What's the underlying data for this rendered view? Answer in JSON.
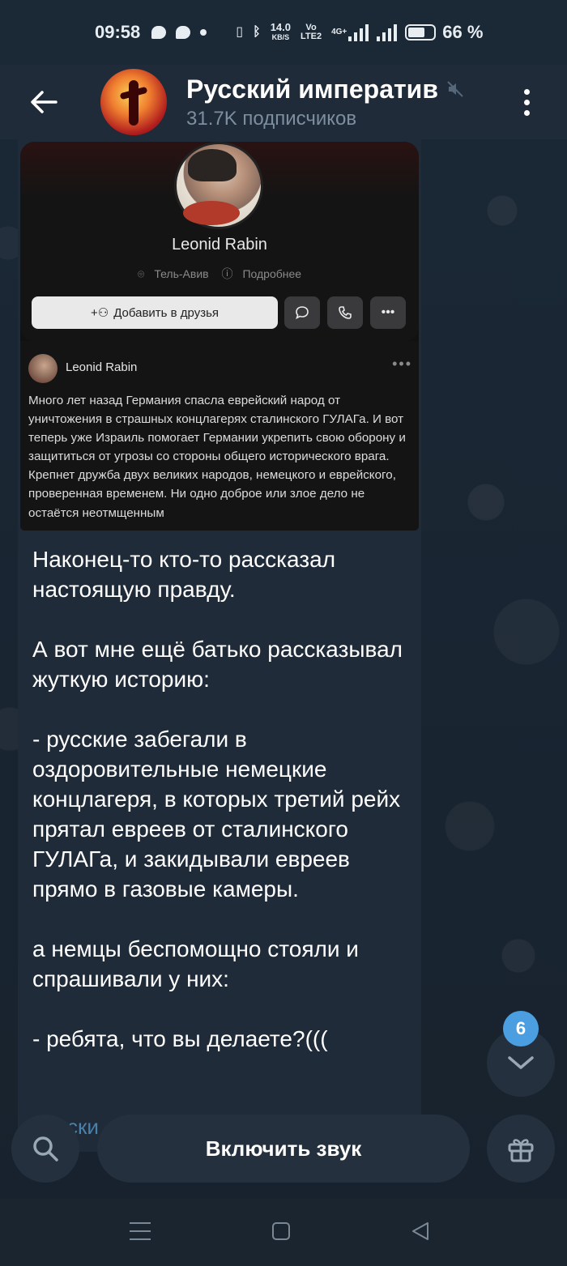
{
  "status_bar": {
    "time": "09:58",
    "network_speed": "14.0",
    "network_speed_unit": "KB/S",
    "volte": "Vo",
    "lte": "LTE2",
    "network_type": "4G+",
    "battery": "66 %"
  },
  "header": {
    "title": "Русский императив",
    "subscribers": "31.7K подписчиков"
  },
  "photo": {
    "profile_name": "Leonid Rabin",
    "location": "Тель-Авив",
    "details": "Подробнее",
    "add_friend": "Добавить в друзья",
    "post_author": "Leonid Rabin",
    "post_text": "Много лет назад Германия спасла еврейский народ от уничтожения в страшных концлагерях сталинского ГУЛАГа. И вот теперь уже Израиль помогает Германии укрепить свою оборону и защититься от угрозы со стороны общего исторического врага. Крепнет дружба двух великих народов, немецкого и еврейского, проверенная временем. Ни одно доброе или злое дело не остаётся неотмщенным"
  },
  "message": {
    "text": "Наконец-то кто-то рассказал настоящую правду.\n\nА вот мне ещё батько рассказывал жуткую историю:\n\n- русские забегали в оздоровительные немецкие концлагеря, в которых третий рейх прятал евреев от сталинского ГУЛАГа, и закидывали евреев прямо в газовые камеры.\n\nа немцы беспомощно стояли и спрашивали у них:\n\n- ребята, что вы делаете?(((",
    "trailing": "Русски"
  },
  "scroll": {
    "unread_count": "6"
  },
  "bottom_bar": {
    "unmute_label": "Включить звук"
  },
  "colors": {
    "accent": "#4b9fe0",
    "header_bg": "#1f2b38",
    "bubble_bg": "#1f2b38"
  }
}
